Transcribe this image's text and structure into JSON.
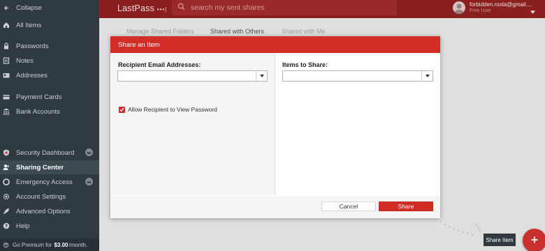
{
  "sidebar": {
    "collapse_label": "Collapse",
    "items": [
      {
        "label": "All Items",
        "icon": "home-icon"
      },
      {
        "label": "Passwords",
        "icon": "lock-icon"
      },
      {
        "label": "Notes",
        "icon": "note-icon"
      },
      {
        "label": "Addresses",
        "icon": "address-card-icon"
      },
      {
        "label": "Payment Cards",
        "icon": "credit-card-icon"
      },
      {
        "label": "Bank Accounts",
        "icon": "bank-icon"
      },
      {
        "label": "Security Dashboard",
        "icon": "shield-icon"
      },
      {
        "label": "Sharing Center",
        "icon": "users-icon"
      },
      {
        "label": "Emergency Access",
        "icon": "lifebuoy-icon"
      },
      {
        "label": "Account Settings",
        "icon": "gear-icon"
      },
      {
        "label": "Advanced Options",
        "icon": "rocket-icon"
      },
      {
        "label": "Help",
        "icon": "question-icon"
      }
    ],
    "premium_prefix": "Go Premium for",
    "premium_price": "$3.00",
    "premium_suffix": "/month."
  },
  "header": {
    "logo_text": "LastPass",
    "logo_dots": "•••|",
    "search_placeholder": "search my sent shares",
    "user_email": "forbidden.roxta@gmail....",
    "user_role": "Free User"
  },
  "tabs": {
    "manage": "Manage Shared Folders",
    "with_others": "Shared with Others",
    "with_me": "Shared with Me"
  },
  "modal": {
    "title": "Share an Item",
    "recipient_label": "Recipient Email Addresses:",
    "recipient_value": "",
    "items_label": "Items to Share:",
    "items_value": "",
    "allow_view_password_label": "Allow Recipient to View Password",
    "allow_view_password_checked": true,
    "cancel_label": "Cancel",
    "share_label": "Share"
  },
  "fab": {
    "tooltip": "Share Item",
    "icon": "plus-icon"
  },
  "colors": {
    "accent": "#d32d27",
    "header": "#8a1f1f",
    "sidebar": "#2f3a40"
  }
}
